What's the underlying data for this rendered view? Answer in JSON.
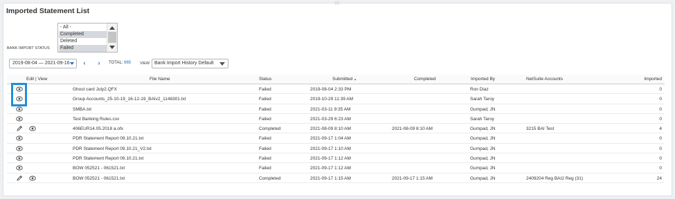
{
  "page": {
    "title": "Imported Statement List"
  },
  "filters": {
    "bank_import_status_label": "BANK IMPORT STATUS",
    "status_options": [
      {
        "label": "- All -",
        "selected": false
      },
      {
        "label": "Completed",
        "selected": true
      },
      {
        "label": "Deleted",
        "selected": false
      },
      {
        "label": "Failed",
        "selected": true
      }
    ]
  },
  "toolbar": {
    "date_range": "2019-08-04 — 2021-09-16",
    "prev": "‹",
    "next": "›",
    "total_label": "TOTAL:",
    "total_count": "665",
    "view_label": "VIEW",
    "view_value": "Bank Import History Default"
  },
  "table": {
    "headers": {
      "edit_view": "Edit | View",
      "file_name": "File Name",
      "status": "Status",
      "submitted": "Submitted",
      "completed": "Completed",
      "imported_by": "Imported By",
      "netsuite_accounts": "NetSuite Accounts",
      "imported": "Imported"
    },
    "rows": [
      {
        "editable": false,
        "file_name": "Ghost card July2.QFX",
        "status": "Failed",
        "submitted": "2019-08-04 2:33 PM",
        "completed": "",
        "imported_by": "Ron Diaz",
        "netsuite_accounts": "",
        "imported": "0"
      },
      {
        "editable": false,
        "file_name": "Group Accounts_25-10-19_16-12-19_BAIv2_1148301.txt",
        "status": "Failed",
        "submitted": "2019-10-29 11:39 AM",
        "completed": "",
        "imported_by": "Sarah Taroy",
        "netsuite_accounts": "",
        "imported": "0"
      },
      {
        "editable": false,
        "file_name": "SMBA.txt",
        "status": "Failed",
        "submitted": "2021-03-11 9:35 AM",
        "completed": "",
        "imported_by": "Gumpad, JN",
        "netsuite_accounts": "",
        "imported": "0"
      },
      {
        "editable": false,
        "file_name": "Test Banking Rules.csv",
        "status": "Failed",
        "submitted": "2021-03-29 6:23 AM",
        "completed": "",
        "imported_by": "Sarah Taroy",
        "netsuite_accounts": "",
        "imported": "0"
      },
      {
        "editable": true,
        "file_name": "406EUR14.05.2018 a.ofx",
        "status": "Completed",
        "submitted": "2021-08-09 8:10 AM",
        "completed": "2021-08-09 8:10 AM",
        "imported_by": "Gumpad, JN",
        "netsuite_accounts": "3215 BAI Test",
        "imported": "4"
      },
      {
        "editable": false,
        "file_name": "PDR Statement Report 09.10.21.txt",
        "status": "Failed",
        "submitted": "2021-09-17 1:04 AM",
        "completed": "",
        "imported_by": "Gumpad, JN",
        "netsuite_accounts": "",
        "imported": "0"
      },
      {
        "editable": false,
        "file_name": "PDR Statement Report 09.10.21_V2.txt",
        "status": "Failed",
        "submitted": "2021-09-17 1:10 AM",
        "completed": "",
        "imported_by": "Gumpad, JN",
        "netsuite_accounts": "",
        "imported": "0"
      },
      {
        "editable": false,
        "file_name": "PDR Statement Report 09.10.21.txt",
        "status": "Failed",
        "submitted": "2021-09-17 1:12 AM",
        "completed": "",
        "imported_by": "Gumpad, JN",
        "netsuite_accounts": "",
        "imported": "0"
      },
      {
        "editable": false,
        "file_name": "BOW 052521 - 061521.txt",
        "status": "Failed",
        "submitted": "2021-09-17 1:12 AM",
        "completed": "",
        "imported_by": "Gumpad, JN",
        "netsuite_accounts": "",
        "imported": "0"
      },
      {
        "editable": true,
        "file_name": "BOW 052521 - 061521.txt",
        "status": "Completed",
        "submitted": "2021-09-17 1:15 AM",
        "completed": "2021-09-17 1:15 AM",
        "imported_by": "Gumpad, JN",
        "netsuite_accounts": "2409204 Reg BAI2 Reg (31)",
        "imported": "24"
      }
    ]
  },
  "icons": {
    "view": "eye-icon",
    "edit": "pencil-icon",
    "sort": "sort-ascending-icon"
  },
  "colors": {
    "accent": "#2a6cb8",
    "highlight": "#1e8fd9"
  }
}
